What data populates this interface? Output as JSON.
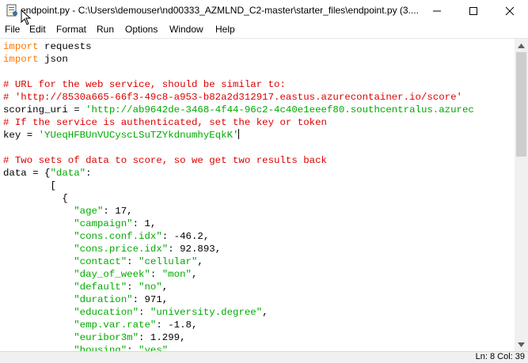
{
  "window": {
    "title": "endpoint.py - C:\\Users\\demouser\\nd00333_AZMLND_C2-master\\starter_files\\endpoint.py (3...."
  },
  "menu": {
    "items": [
      "File",
      "Edit",
      "Format",
      "Run",
      "Options",
      "Window",
      "Help"
    ]
  },
  "code_lines": [
    [
      {
        "t": "import",
        "c": "kw"
      },
      {
        "t": " requests",
        "c": ""
      }
    ],
    [
      {
        "t": "import",
        "c": "kw"
      },
      {
        "t": " json",
        "c": ""
      }
    ],
    [
      {
        "t": "",
        "c": ""
      }
    ],
    [
      {
        "t": "# URL for the web service, should be similar to:",
        "c": "cm"
      }
    ],
    [
      {
        "t": "# 'http://8530a665-66f3-49c8-a953-b82a2d312917.eastus.azurecontainer.io/score'",
        "c": "cm"
      }
    ],
    [
      {
        "t": "scoring_uri = ",
        "c": ""
      },
      {
        "t": "'http://ab9642de-3468-4f44-96c2-4c40e1eeef80.southcentralus.azurec",
        "c": "st"
      }
    ],
    [
      {
        "t": "# If the service is authenticated, set the key or token",
        "c": "cm"
      }
    ],
    [
      {
        "t": "key = ",
        "c": ""
      },
      {
        "t": "'YUeqHFBUnVUCyscLSuTZYkdnumhyEqkK'",
        "c": "st"
      }
    ],
    [
      {
        "t": "",
        "c": ""
      }
    ],
    [
      {
        "t": "# Two sets of data to score, so we get two results back",
        "c": "cm"
      }
    ],
    [
      {
        "t": "data = {",
        "c": ""
      },
      {
        "t": "\"data\"",
        "c": "st"
      },
      {
        "t": ":",
        "c": ""
      }
    ],
    [
      {
        "t": "        [",
        "c": ""
      }
    ],
    [
      {
        "t": "          {",
        "c": ""
      }
    ],
    [
      {
        "t": "            ",
        "c": ""
      },
      {
        "t": "\"age\"",
        "c": "st"
      },
      {
        "t": ": 17,",
        "c": ""
      }
    ],
    [
      {
        "t": "            ",
        "c": ""
      },
      {
        "t": "\"campaign\"",
        "c": "st"
      },
      {
        "t": ": 1,",
        "c": ""
      }
    ],
    [
      {
        "t": "            ",
        "c": ""
      },
      {
        "t": "\"cons.conf.idx\"",
        "c": "st"
      },
      {
        "t": ": -46.2,",
        "c": ""
      }
    ],
    [
      {
        "t": "            ",
        "c": ""
      },
      {
        "t": "\"cons.price.idx\"",
        "c": "st"
      },
      {
        "t": ": 92.893,",
        "c": ""
      }
    ],
    [
      {
        "t": "            ",
        "c": ""
      },
      {
        "t": "\"contact\"",
        "c": "st"
      },
      {
        "t": ": ",
        "c": ""
      },
      {
        "t": "\"cellular\"",
        "c": "st"
      },
      {
        "t": ",",
        "c": ""
      }
    ],
    [
      {
        "t": "            ",
        "c": ""
      },
      {
        "t": "\"day_of_week\"",
        "c": "st"
      },
      {
        "t": ": ",
        "c": ""
      },
      {
        "t": "\"mon\"",
        "c": "st"
      },
      {
        "t": ",",
        "c": ""
      }
    ],
    [
      {
        "t": "            ",
        "c": ""
      },
      {
        "t": "\"default\"",
        "c": "st"
      },
      {
        "t": ": ",
        "c": ""
      },
      {
        "t": "\"no\"",
        "c": "st"
      },
      {
        "t": ",",
        "c": ""
      }
    ],
    [
      {
        "t": "            ",
        "c": ""
      },
      {
        "t": "\"duration\"",
        "c": "st"
      },
      {
        "t": ": 971,",
        "c": ""
      }
    ],
    [
      {
        "t": "            ",
        "c": ""
      },
      {
        "t": "\"education\"",
        "c": "st"
      },
      {
        "t": ": ",
        "c": ""
      },
      {
        "t": "\"university.degree\"",
        "c": "st"
      },
      {
        "t": ",",
        "c": ""
      }
    ],
    [
      {
        "t": "            ",
        "c": ""
      },
      {
        "t": "\"emp.var.rate\"",
        "c": "st"
      },
      {
        "t": ": -1.8,",
        "c": ""
      }
    ],
    [
      {
        "t": "            ",
        "c": ""
      },
      {
        "t": "\"euribor3m\"",
        "c": "st"
      },
      {
        "t": ": 1.299,",
        "c": ""
      }
    ],
    [
      {
        "t": "            ",
        "c": ""
      },
      {
        "t": "\"housing\"",
        "c": "st"
      },
      {
        "t": ": ",
        "c": ""
      },
      {
        "t": "\"yes\"",
        "c": "st"
      },
      {
        "t": ",",
        "c": ""
      }
    ]
  ],
  "status": {
    "position": "Ln: 8   Col: 39"
  },
  "colors": {
    "keyword": "#ff7700",
    "comment": "#dd0000",
    "string": "#00aa00"
  }
}
